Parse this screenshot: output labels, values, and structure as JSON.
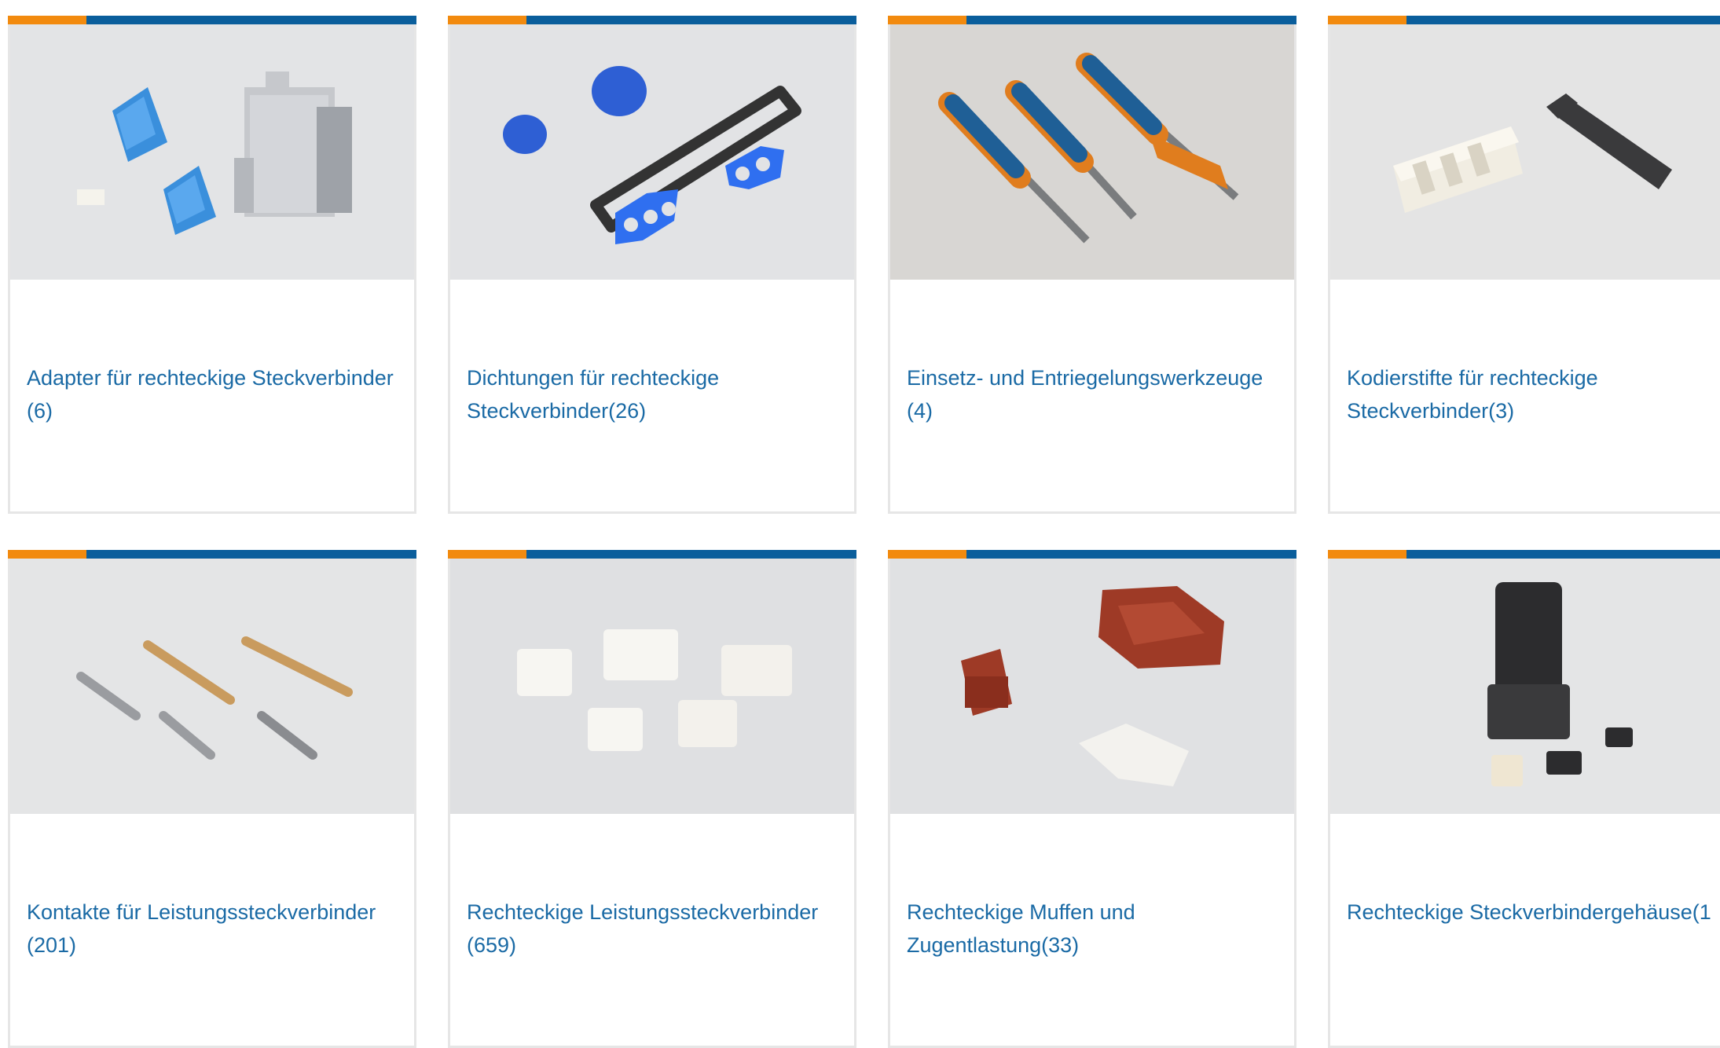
{
  "accent_color": "#f28a0e",
  "bar_color": "#0a5e9c",
  "link_color": "#1a6aa5",
  "cards": [
    {
      "title": "Adapter für rechteckige Steckverbinder",
      "count": "(6)",
      "image": "blue-adapters-and-grey-housing"
    },
    {
      "title": "Dichtungen für rechteckige Steckverbinder",
      "count": "(26)",
      "image": "blue-seals-and-black-gasket"
    },
    {
      "title": "Einsetz- und Entriegelungswerkzeuge",
      "count": "(4)",
      "image": "blue-orange-extraction-tools"
    },
    {
      "title": "Kodierstifte für rechteckige Steckverbinder",
      "count": "(3)",
      "image": "white-and-black-coding-pins"
    },
    {
      "title": "Kontakte für Leistungssteckverbinder",
      "count": "(201)",
      "image": "metal-crimp-contacts"
    },
    {
      "title": "Rechteckige Leistungssteckverbinder",
      "count": "(659)",
      "image": "white-power-connectors"
    },
    {
      "title": "Rechteckige Muffen und Zugentlastung",
      "count": "(33)",
      "image": "red-hoods-and-strain-relief"
    },
    {
      "title": "Rechteckige Steckverbindergehäuse",
      "count": "(1",
      "image": "black-connector-housing"
    }
  ]
}
